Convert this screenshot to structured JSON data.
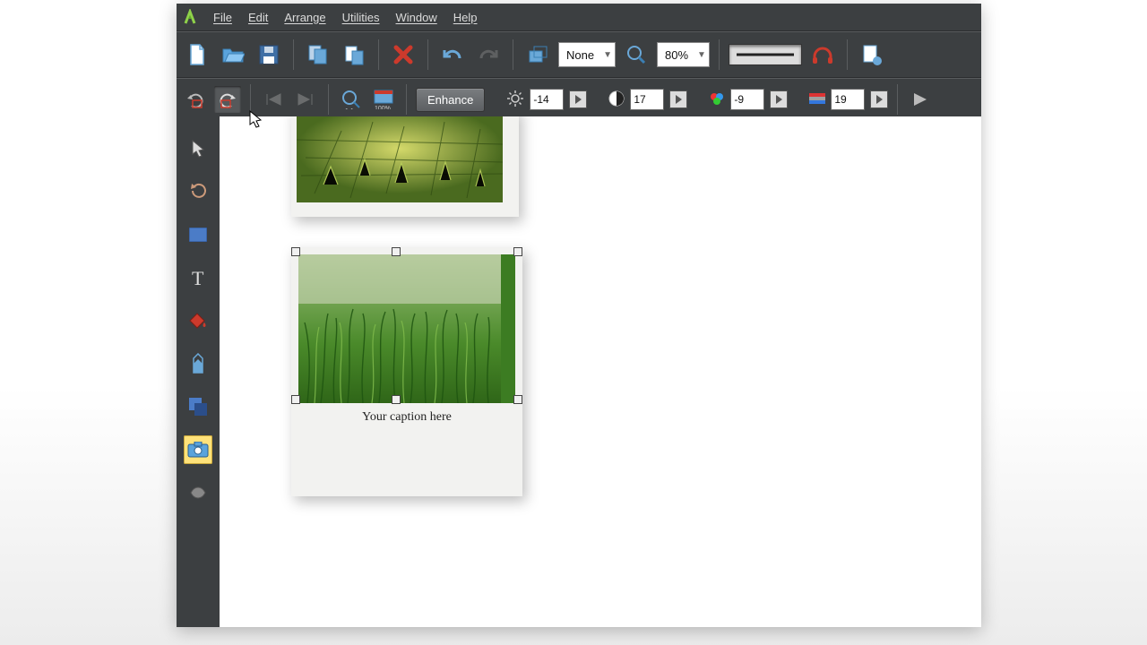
{
  "menu": {
    "items": [
      "File",
      "Edit",
      "Arrange",
      "Utilities",
      "Window",
      "Help"
    ]
  },
  "toolbar1": {
    "snap_label": "None",
    "zoom_label": "80%"
  },
  "toolbar2": {
    "enhance_label": "Enhance",
    "brightness_value": "-14",
    "contrast_value": "17",
    "saturation_value": "-9",
    "hue_value": "19"
  },
  "caption_text": "Your caption here"
}
